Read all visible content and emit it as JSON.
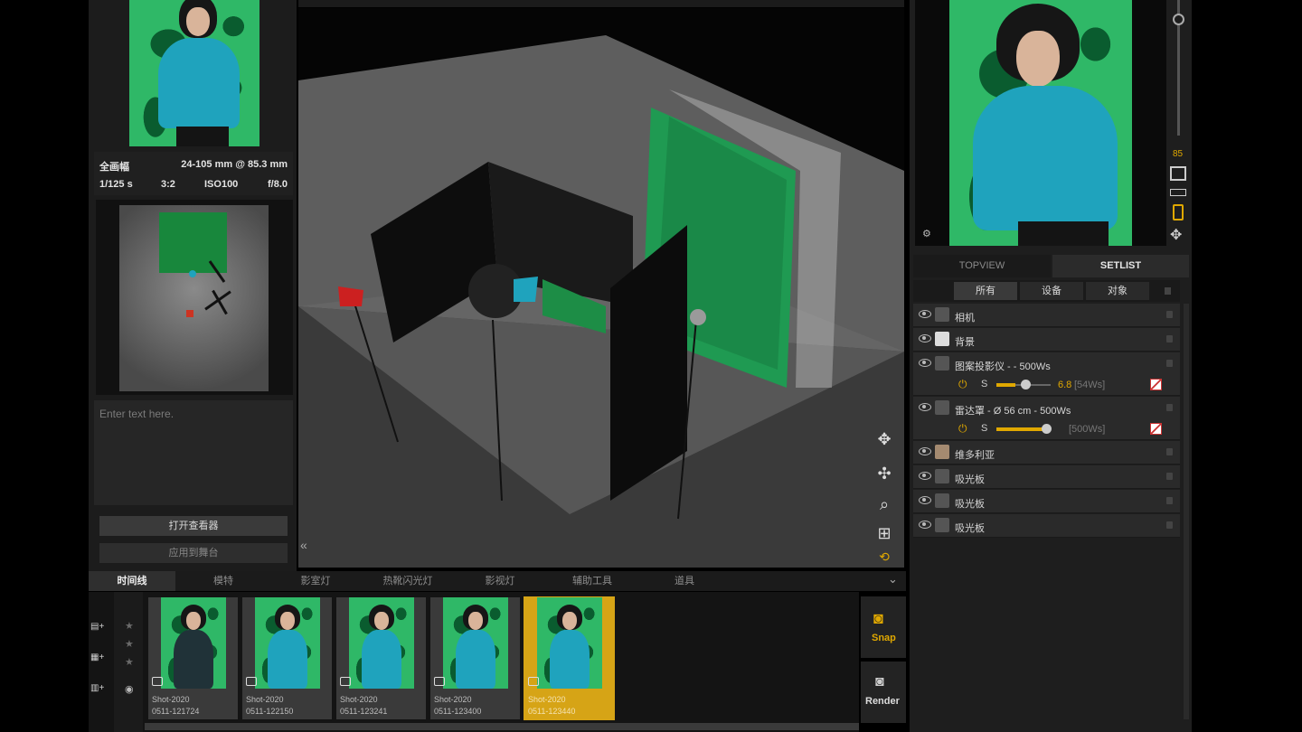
{
  "left": {
    "camera_info": {
      "format": "全画幅",
      "lens": "24-105 mm @ 85.3 mm",
      "shutter": "1/125 s",
      "ratio": "3:2",
      "iso": "ISO100",
      "aperture": "f/8.0"
    },
    "notes_placeholder": "Enter text here.",
    "open_viewer": "打开查看器",
    "apply_stage": "应用到舞台"
  },
  "viewport": {
    "collapse_icon": "«"
  },
  "right": {
    "zoom_value": "85",
    "tabs": [
      "TOPVIEW",
      "SETLIST"
    ],
    "filters": [
      "所有",
      "设备",
      "对象"
    ],
    "items": [
      {
        "label": "相机"
      },
      {
        "label": "背景"
      },
      {
        "label": "图案投影仪 - - 500Ws",
        "sub": {
          "mode": "S",
          "value": "6.8",
          "power": "[54Ws]",
          "slider": 0.35
        }
      },
      {
        "label": "雷达罩 - Ø 56 cm - 500Ws",
        "sub": {
          "mode": "S",
          "value": "",
          "power": "[500Ws]",
          "slider": 0.9
        }
      },
      {
        "label": "维多利亚"
      },
      {
        "label": "吸光板"
      },
      {
        "label": "吸光板"
      },
      {
        "label": "吸光板"
      }
    ]
  },
  "bottom": {
    "tabs": [
      "时间线",
      "模特",
      "影室灯",
      "热靴闪光灯",
      "影视灯",
      "辅助工具",
      "道具"
    ],
    "shots": [
      {
        "line1": "Shot-2020",
        "line2": "0511-121724"
      },
      {
        "line1": "Shot-2020",
        "line2": "0511-122150"
      },
      {
        "line1": "Shot-2020",
        "line2": "0511-123241"
      },
      {
        "line1": "Shot-2020",
        "line2": "0511-123400"
      },
      {
        "line1": "Shot-2020",
        "line2": "0511-123440"
      }
    ],
    "snap_label": "Snap",
    "render_label": "Render"
  },
  "colors": {
    "accent": "#e0a800",
    "selected_shot": "#d6a416",
    "backdrop_green": "#2fb867"
  }
}
